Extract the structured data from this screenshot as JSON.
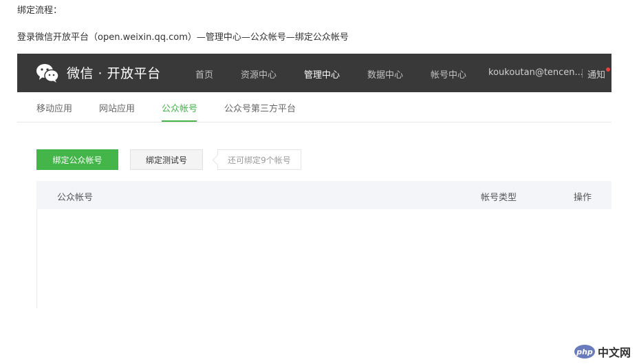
{
  "intro": {
    "line1": "绑定流程：",
    "line2": "登录微信开放平台（open.weixin.qq.com）—管理中心—公众帐号—绑定公众帐号"
  },
  "topnav": {
    "brand": "微信 · 开放平台",
    "items": [
      "首页",
      "资源中心",
      "管理中心",
      "数据中心",
      "帐号中心"
    ],
    "active_index": 2,
    "account": "koukoutan@tencen...",
    "notice": "通知"
  },
  "subtabs": {
    "items": [
      "移动应用",
      "网站应用",
      "公众帐号",
      "公众号第三方平台"
    ],
    "active_index": 2
  },
  "actions": {
    "bind_public": "绑定公众帐号",
    "bind_test": "绑定测试号",
    "remaining_hint": "还可绑定9个帐号"
  },
  "table": {
    "columns": [
      "公众帐号",
      "帐号类型",
      "操作"
    ]
  },
  "watermark": {
    "logo": "php",
    "text": "中文网"
  },
  "colors": {
    "accent": "#44b549",
    "topbar": "#393939",
    "notice_dot": "#e64340"
  }
}
